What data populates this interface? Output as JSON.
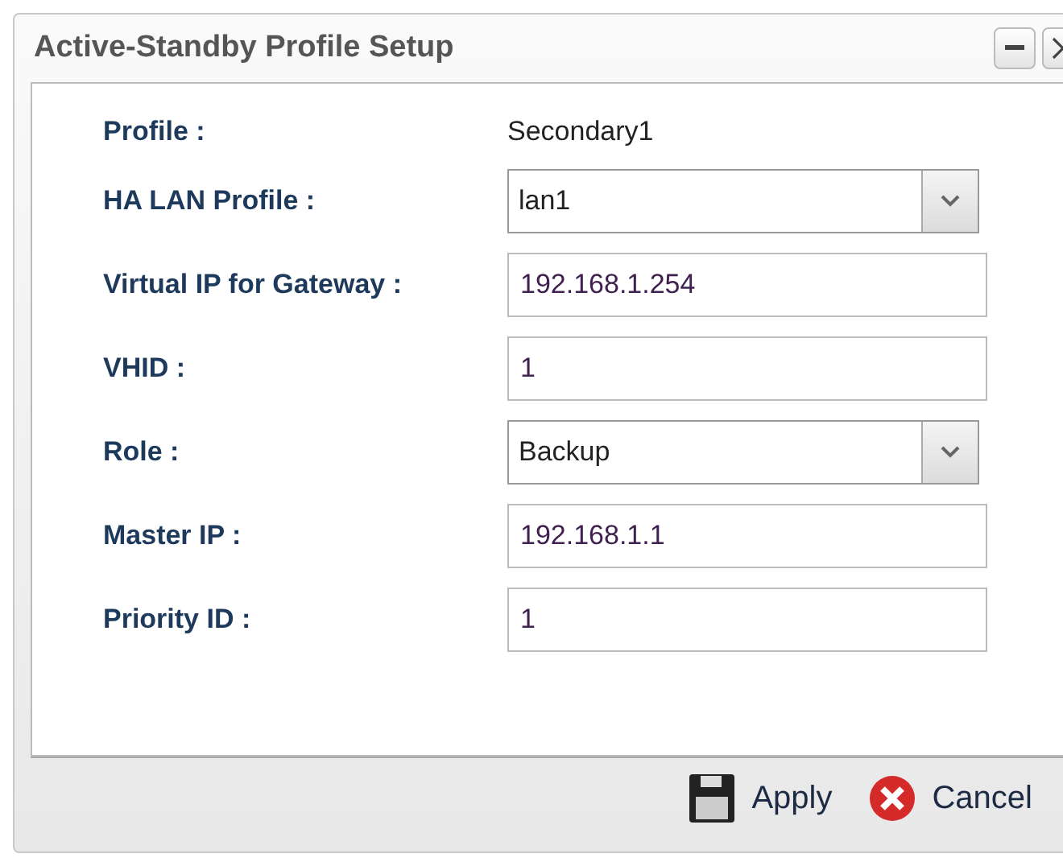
{
  "window": {
    "title": "Active-Standby Profile Setup"
  },
  "fields": [
    {
      "kind": "static",
      "label": "Profile :",
      "value": "Secondary1"
    },
    {
      "kind": "select",
      "label": "HA LAN Profile :",
      "value": "lan1"
    },
    {
      "kind": "text",
      "label": "Virtual IP for Gateway :",
      "value": "192.168.1.254"
    },
    {
      "kind": "text",
      "label": "VHID :",
      "value": "1"
    },
    {
      "kind": "select",
      "label": "Role :",
      "value": "Backup"
    },
    {
      "kind": "text",
      "label": "Master IP :",
      "value": "192.168.1.1"
    },
    {
      "kind": "text",
      "label": "Priority ID :",
      "value": "1"
    }
  ],
  "buttons": [
    {
      "kind": "apply",
      "label": "Apply"
    },
    {
      "kind": "cancel",
      "label": "Cancel"
    }
  ]
}
